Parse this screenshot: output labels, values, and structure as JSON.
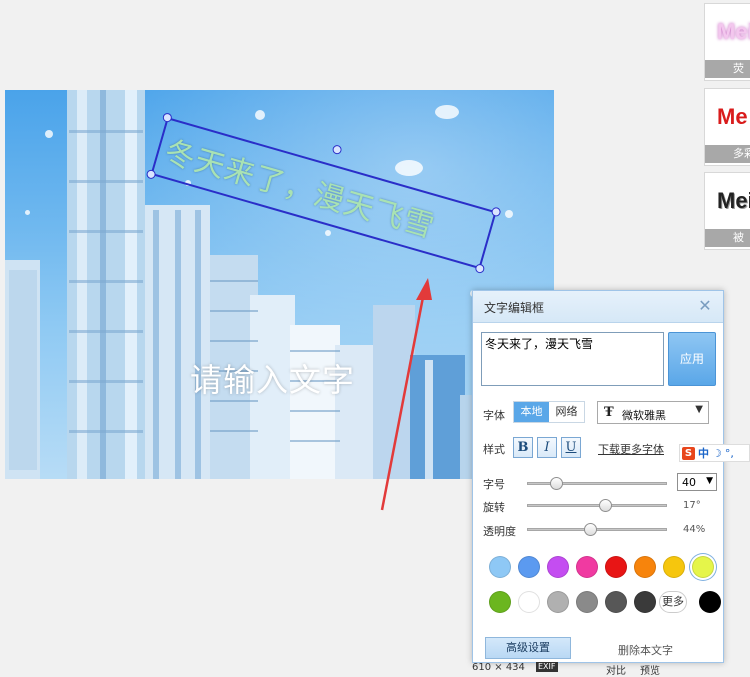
{
  "presets": [
    {
      "sample": "Mei",
      "caption": "荧",
      "color": "#f3c7ee"
    },
    {
      "sample": "Me",
      "caption": "多彩",
      "color": "#d91c1c"
    },
    {
      "sample": "Mei",
      "caption": "被",
      "color": "#222222"
    }
  ],
  "canvas": {
    "overlay_text": "冬天来了，漫天飞雪",
    "placeholder_text": "请输入文字"
  },
  "editor": {
    "title": "文字编辑框",
    "close_icon": "close-icon",
    "text_value": "冬天来了，漫天飞雪",
    "apply_label": "应用",
    "font_label": "字体",
    "font_source_tabs": [
      "本地",
      "网络"
    ],
    "font_name": "微软雅黑",
    "style_label": "样式",
    "style_buttons": [
      "B",
      "I",
      "U"
    ],
    "download_more_fonts": "下载更多字体",
    "size_label": "字号",
    "size_value": "40",
    "rotate_label": "旋转",
    "rotate_value": "17°",
    "opacity_label": "透明度",
    "opacity_value": "44%",
    "slider_levels": {
      "size": 0.2,
      "rotate": 0.55,
      "opacity": 0.44
    },
    "colors_row1": [
      "#8ec8f5",
      "#5b9af0",
      "#c44df1",
      "#f03aa1",
      "#e81515",
      "#f7840c",
      "#f6c60d",
      "#e5f54a"
    ],
    "colors_row2": [
      "#6bb61f",
      "#ffffff",
      "#b0b0b0",
      "#8a8a8a",
      "#575757",
      "#3a3a3a",
      "#000000"
    ],
    "more_colors": "更多",
    "advanced_settings": "高级设置",
    "save_text": "删除本文字"
  },
  "ime": {
    "brand": "S",
    "mode": "中"
  },
  "status_bar": {
    "dimensions": "610 × 434",
    "exif": "EXIF",
    "compare": "对比",
    "extra": "预览"
  }
}
